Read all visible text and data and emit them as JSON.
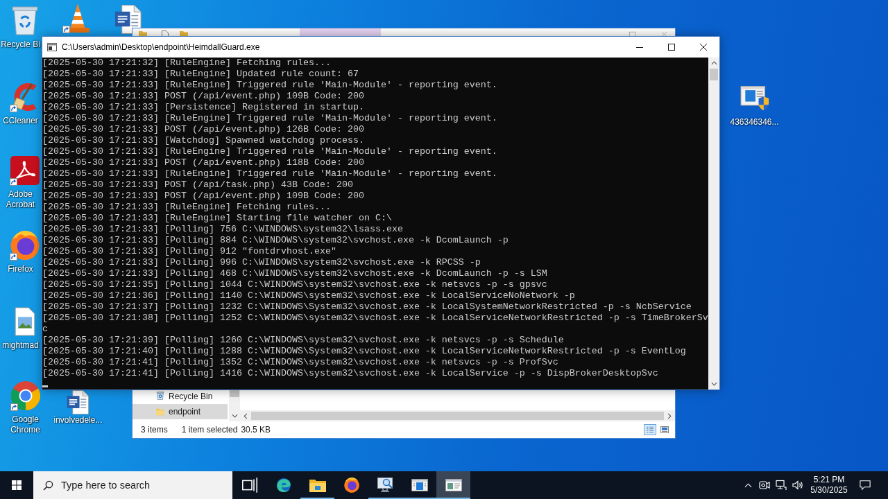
{
  "desktop_icons": [
    {
      "kind": "bin",
      "label": "Recycle Bi",
      "shortcut": false
    },
    {
      "kind": "cone",
      "shortcut": true
    },
    {
      "kind": "doc",
      "shortcut": false
    },
    {
      "kind": "cleaner",
      "label": "CCleaner",
      "shortcut": true
    },
    {
      "kind": "pdf",
      "label": "Adobe Acrobat",
      "shortcut": true
    },
    {
      "kind": "fox",
      "label": "Firefox",
      "shortcut": true
    },
    {
      "kind": "image",
      "label": "mightmad",
      "shortcut": false
    },
    {
      "kind": "chrome",
      "label": "Google Chrome",
      "shortcut": true
    },
    {
      "kind": "doc",
      "label": "involvedele...",
      "shortcut": false
    },
    {
      "kind": "exe",
      "label": "436346346...",
      "shortcut": false
    }
  ],
  "explorer_window": {
    "nav_items": [
      {
        "kind": "bin",
        "label": "Recycle Bin",
        "selected": false
      },
      {
        "kind": "folder",
        "label": "endpoint",
        "selected": true
      }
    ],
    "status_bar": {
      "items": "3 items",
      "selection": "1 item selected",
      "size": "30.5 KB"
    },
    "view_buttons": [
      {
        "kind": "details",
        "selected": true
      },
      {
        "kind": "tiles",
        "selected": false
      }
    ]
  },
  "console_window": {
    "title": "C:\\Users\\admin\\Desktop\\endpoint\\HeimdallGuard.exe",
    "lines": [
      "[2025-05-30 17:21:32] [RuleEngine] Fetching rules...",
      "[2025-05-30 17:21:33] [RuleEngine] Updated rule count: 67",
      "[2025-05-30 17:21:33] [RuleEngine] Triggered rule 'Main-Module' - reporting event.",
      "[2025-05-30 17:21:33] POST (/api/event.php) 109B Code: 200",
      "[2025-05-30 17:21:33] [Persistence] Registered in startup.",
      "[2025-05-30 17:21:33] [RuleEngine] Triggered rule 'Main-Module' - reporting event.",
      "[2025-05-30 17:21:33] POST (/api/event.php) 126B Code: 200",
      "[2025-05-30 17:21:33] [Watchdog] Spawned watchdog process.",
      "[2025-05-30 17:21:33] [RuleEngine] Triggered rule 'Main-Module' - reporting event.",
      "[2025-05-30 17:21:33] POST (/api/event.php) 118B Code: 200",
      "[2025-05-30 17:21:33] [RuleEngine] Triggered rule 'Main-Module' - reporting event.",
      "[2025-05-30 17:21:33] POST (/api/task.php) 43B Code: 200",
      "[2025-05-30 17:21:33] POST (/api/event.php) 109B Code: 200",
      "[2025-05-30 17:21:33] [RuleEngine] Fetching rules...",
      "[2025-05-30 17:21:33] [RuleEngine] Starting file watcher on C:\\",
      "[2025-05-30 17:21:33] [Polling] 756 C:\\WINDOWS\\system32\\lsass.exe",
      "[2025-05-30 17:21:33] [Polling] 884 C:\\WINDOWS\\system32\\svchost.exe -k DcomLaunch -p",
      "[2025-05-30 17:21:33] [Polling] 912 \"fontdrvhost.exe\"",
      "[2025-05-30 17:21:33] [Polling] 996 C:\\WINDOWS\\system32\\svchost.exe -k RPCSS -p",
      "[2025-05-30 17:21:33] [Polling] 468 C:\\WINDOWS\\system32\\svchost.exe -k DcomLaunch -p -s LSM",
      "[2025-05-30 17:21:35] [Polling] 1044 C:\\WINDOWS\\system32\\svchost.exe -k netsvcs -p -s gpsvc",
      "[2025-05-30 17:21:36] [Polling] 1140 C:\\WINDOWS\\system32\\svchost.exe -k LocalServiceNoNetwork -p",
      "[2025-05-30 17:21:37] [Polling] 1232 C:\\WINDOWS\\System32\\svchost.exe -k LocalSystemNetworkRestricted -p -s NcbService",
      "[2025-05-30 17:21:38] [Polling] 1252 C:\\WINDOWS\\system32\\svchost.exe -k LocalServiceNetworkRestricted -p -s TimeBrokerSvc",
      "[2025-05-30 17:21:39] [Polling] 1260 C:\\WINDOWS\\system32\\svchost.exe -k netsvcs -p -s Schedule",
      "[2025-05-30 17:21:40] [Polling] 1288 C:\\WINDOWS\\System32\\svchost.exe -k LocalServiceNetworkRestricted -p -s EventLog",
      "[2025-05-30 17:21:41] [Polling] 1352 C:\\WINDOWS\\system32\\svchost.exe -k netsvcs -p -s ProfSvc",
      "[2025-05-30 17:21:41] [Polling] 1416 C:\\WINDOWS\\system32\\svchost.exe -k LocalService -p -s DispBrokerDesktopSvc"
    ]
  },
  "taskbar": {
    "search": {
      "placeholder": "Type here to search"
    },
    "apps": [
      {
        "kind": "taskview",
        "open": false,
        "selected": false
      },
      {
        "kind": "edge",
        "open": false,
        "selected": false
      },
      {
        "kind": "explorer",
        "open": true,
        "selected": false
      },
      {
        "kind": "firefox",
        "open": false,
        "selected": false
      },
      {
        "kind": "magnifier",
        "open": true,
        "selected": false
      },
      {
        "kind": "window",
        "open": true,
        "selected": false
      },
      {
        "kind": "console",
        "open": true,
        "selected": true
      }
    ],
    "clock": {
      "time": "5:21 PM",
      "date": "5/30/2025"
    }
  }
}
